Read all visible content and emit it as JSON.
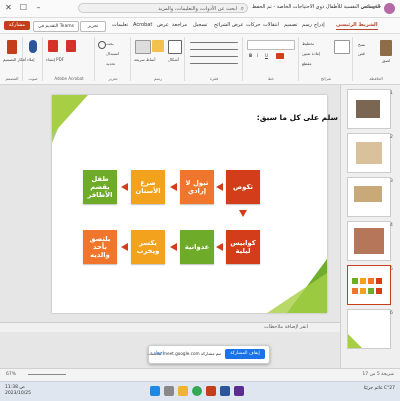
{
  "titlebar": {
    "search_text": "ابحث عن الأدوات، والتعليمات، والمزيد",
    "file_name": "الخصائص النفسية للأطفال ذوي الاحتياجات الخاصة - تم الحفظ",
    "user_name": "حنان فتحي"
  },
  "ribbon_tabs": [
    "الشريط الرئيسي",
    "إدراج",
    "رسم",
    "تصميم",
    "انتقالات",
    "حركات",
    "عرض الشرائح",
    "تسجيل",
    "مراجعة",
    "عرض",
    "Acrobat",
    "تعليمات"
  ],
  "buttons": {
    "share": "مشاركة",
    "teams": "التقديم في Teams",
    "edit": "تحرير"
  },
  "ribbon_groups": [
    {
      "label": "الحافظة",
      "items": [
        "لصق",
        "نسخ",
        "قص"
      ]
    },
    {
      "label": "شرائح",
      "items": [
        "شريحة جديدة",
        "تخطيط",
        "إعادة تعيين",
        "مقطع"
      ]
    },
    {
      "label": "خط",
      "items": [
        "B",
        "I",
        "U"
      ]
    },
    {
      "label": "فقرة",
      "items": []
    },
    {
      "label": "رسم",
      "items": [
        "أشكال",
        "ترتيب",
        "أنماط سريعة"
      ]
    },
    {
      "label": "تحرير",
      "items": [
        "بحث",
        "استبدال",
        "تحديد"
      ]
    },
    {
      "label": "Adobe Acrobat",
      "items": [
        "إنشاء ملف PDF ومشاركة الارتباط",
        "إنشاء PDF"
      ]
    },
    {
      "label": "صوت",
      "items": [
        "إملاء"
      ]
    },
    {
      "label": "المصمم",
      "items": [
        "أفكار التصميم"
      ]
    }
  ],
  "slide": {
    "title": "سلم على كل ما سبق:",
    "boxes": [
      {
        "text": "تكوص"
      },
      {
        "text": "تبول لا إرادي"
      },
      {
        "text": "صرع الأسنان"
      },
      {
        "text": "طفل يقضم الأظافر"
      },
      {
        "text": "كوابيس ليلية"
      },
      {
        "text": "عدوانية"
      },
      {
        "text": "يكسر ويخرب"
      },
      {
        "text": "يلتصق بأحد والديه"
      }
    ]
  },
  "notes_label": "انقر لإضافة ملاحظات",
  "thumbnail_numbers": [
    "1",
    "2",
    "3",
    "4",
    "5",
    "6"
  ],
  "notification": {
    "message": "تتم مشاركة meet.google.com شاشتك.",
    "stop_label": "إيقاف المشاركة",
    "hide_label": "إخفاء"
  },
  "statusbar": {
    "slide_info": "شريحة 5 من 17",
    "zoom": "67%"
  },
  "taskbar": {
    "weather": "C°27 غائم جزئيًا",
    "time": "11:38 ص",
    "date": "2023/10/25"
  },
  "colors": {
    "accent": "#c43e1c",
    "box_red": "#d43d1a",
    "box_orange": "#f0762d",
    "box_amber": "#f3a21e",
    "box_green": "#6eab28"
  }
}
